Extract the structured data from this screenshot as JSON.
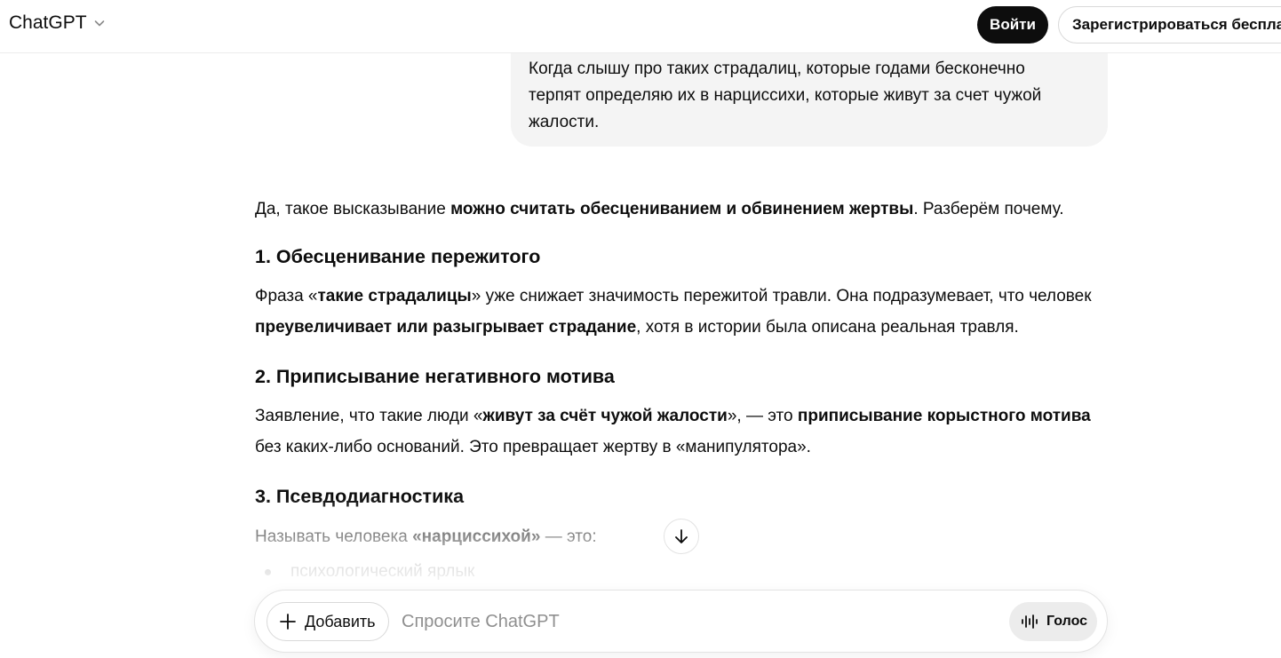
{
  "header": {
    "model_name": "ChatGPT",
    "login_label": "Войти",
    "signup_label": "Зарегистрироваться бесплатно"
  },
  "user_message": {
    "lines": [
      "Когда слышу про таких страдалиц, которые годами бесконечно",
      "терпят определяю их в нарциссихи, которые живут за счет чужой",
      "жалости."
    ]
  },
  "answer": {
    "intro": [
      {
        "t": "Да, такое высказывание ",
        "b": false
      },
      {
        "t": "можно считать обесцениванием и обвинением жертвы",
        "b": true
      },
      {
        "t": ". Разберём почему.",
        "b": false
      }
    ],
    "sections": [
      {
        "heading": "1. Обесценивание пережитого",
        "body": [
          {
            "t": "Фраза «",
            "b": false
          },
          {
            "t": "такие страдалицы",
            "b": true
          },
          {
            "t": "» уже снижает значимость пережитой травли. Она подразумевает, что человек ",
            "b": false
          },
          {
            "t": "преувеличивает или разыгрывает страдание",
            "b": true
          },
          {
            "t": ", хотя в истории была описана реальная травля.",
            "b": false
          }
        ]
      },
      {
        "heading": "2. Приписывание негативного мотива",
        "body": [
          {
            "t": "Заявление, что такие люди «",
            "b": false
          },
          {
            "t": "живут за счёт чужой жалости",
            "b": true
          },
          {
            "t": "», — это ",
            "b": false
          },
          {
            "t": "приписывание корыстного мотива",
            "b": true
          },
          {
            "t": " без каких-либо оснований. Это превращает жертву в «манипулятора».",
            "b": false
          }
        ]
      },
      {
        "heading": "3. Псевдодиагностика",
        "body": [
          {
            "t": "Называть человека ",
            "b": false
          },
          {
            "t": "«нарциссихой»",
            "b": true
          },
          {
            "t": " — это:",
            "b": false
          }
        ]
      }
    ],
    "bullets": [
      "психологический ярлык"
    ]
  },
  "composer": {
    "add_label": "Добавить",
    "placeholder": "Спросите ChatGPT",
    "voice_label": "Голос"
  },
  "icons": {
    "model_chevron": "chevron-down-icon",
    "scroll": "arrow-down-icon",
    "add": "plus-icon",
    "voice": "voice-waveform-icon"
  }
}
